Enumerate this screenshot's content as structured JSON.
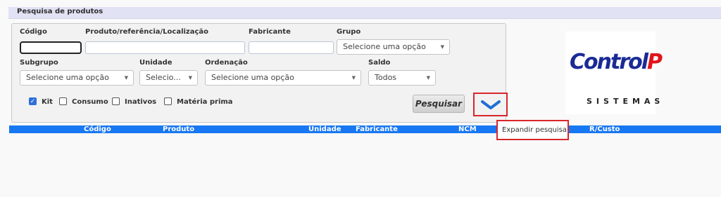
{
  "title": "Pesquisa de produtos",
  "filters": {
    "codigo_label": "Código",
    "produto_label": "Produto/referência/Localização",
    "fabricante_label": "Fabricante",
    "grupo_label": "Grupo",
    "grupo_value": "Selecione uma opção",
    "subgrupo_label": "Subgrupo",
    "subgrupo_value": "Selecione uma opção",
    "unidade_label": "Unidade",
    "unidade_value": "Selecio...",
    "ordenacao_label": "Ordenação",
    "ordenacao_value": "Selecione uma opção",
    "saldo_label": "Saldo",
    "saldo_value": "Todos"
  },
  "checkboxes": [
    {
      "label": "Kit",
      "checked": true
    },
    {
      "label": "Consumo",
      "checked": false
    },
    {
      "label": "Inativos",
      "checked": false
    },
    {
      "label": "Matéria prima",
      "checked": false
    }
  ],
  "buttons": {
    "search_label": "Pesquisar",
    "expand_tooltip": "Expandir pesquisa"
  },
  "table": {
    "columns": [
      "Código",
      "Produto",
      "Unidade",
      "Fabricante",
      "NCM",
      "R/Custo"
    ]
  },
  "logo": {
    "main_text_blue": "Control",
    "main_text_red": "P",
    "sub_text": "SISTEMAS"
  },
  "colors": {
    "header_bar": "#1877f2",
    "highlight": "#d8262b",
    "logo_blue": "#1a2b96",
    "logo_red": "#e0151b"
  }
}
